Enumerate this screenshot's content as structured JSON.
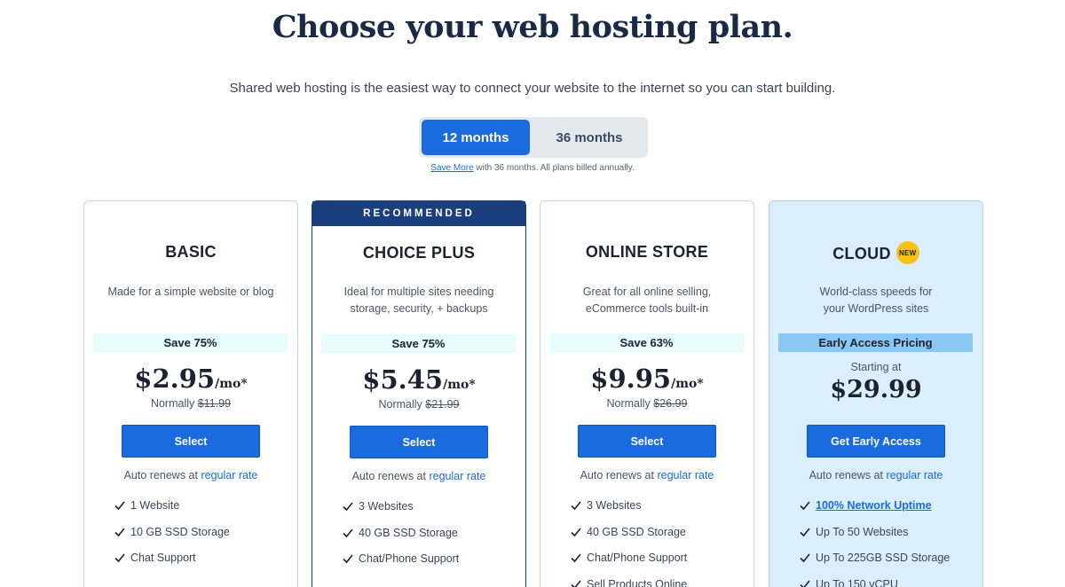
{
  "header": {
    "title": "Choose your web hosting plan.",
    "subtitle": "Shared web hosting is the easiest way to connect your website to the internet so you can start building."
  },
  "term_toggle": {
    "options": [
      "12 months",
      "36 months"
    ],
    "selected": "12 months"
  },
  "billing_note": {
    "link": "Save More",
    "text": " with 36 months. All plans billed annually."
  },
  "colors": {
    "accent": "#196bde",
    "navy": "#1b3f7c",
    "badge": "#f7c11a",
    "cloud_bg": "#dbeefc"
  },
  "plans": [
    {
      "name": "BASIC",
      "description": "Made for a simple website or blog",
      "save": "Save 75%",
      "price": "$2.95",
      "price_suffix": "/mo*",
      "normally_label": "Normally ",
      "normal_price": "$11.99",
      "button": "Select",
      "renew_text": "Auto renews at ",
      "renew_link": "regular rate",
      "features": [
        "1 Website",
        "10 GB SSD Storage",
        "Chat Support"
      ]
    },
    {
      "banner": "RECOMMENDED",
      "name": "CHOICE PLUS",
      "description_lines": [
        "Ideal for multiple sites needing",
        "storage, security, + backups"
      ],
      "save": "Save 75%",
      "price": "$5.45",
      "price_suffix": "/mo*",
      "normally_label": "Normally ",
      "normal_price": "$21.99",
      "button": "Select",
      "renew_text": "Auto renews at ",
      "renew_link": "regular rate",
      "features": [
        "3 Websites",
        "40 GB SSD Storage",
        "Chat/Phone Support"
      ]
    },
    {
      "name": "ONLINE STORE",
      "description_lines": [
        "Great for all online selling,",
        "eCommerce tools built-in"
      ],
      "save": "Save 63%",
      "price": "$9.95",
      "price_suffix": "/mo*",
      "normally_label": "Normally ",
      "normal_price": "$26.99",
      "button": "Select",
      "renew_text": "Auto renews at ",
      "renew_link": "regular rate",
      "features": [
        "3 Websites",
        "40 GB SSD Storage",
        "Chat/Phone Support",
        "Sell Products Online"
      ]
    },
    {
      "name": "CLOUD",
      "badge": "NEW",
      "description_lines": [
        "World-class speeds for",
        "your WordPress sites"
      ],
      "save": "Early Access Pricing",
      "starting_at": "Starting at",
      "price": "$29.99",
      "button": "Get Early Access",
      "renew_text": "Auto renews at ",
      "renew_link": "regular rate",
      "feature_link": "100% Network Uptime",
      "features": [
        "Up To 50 Websites",
        "Up To 225GB SSD Storage",
        "Up To 150 vCPU"
      ]
    }
  ]
}
